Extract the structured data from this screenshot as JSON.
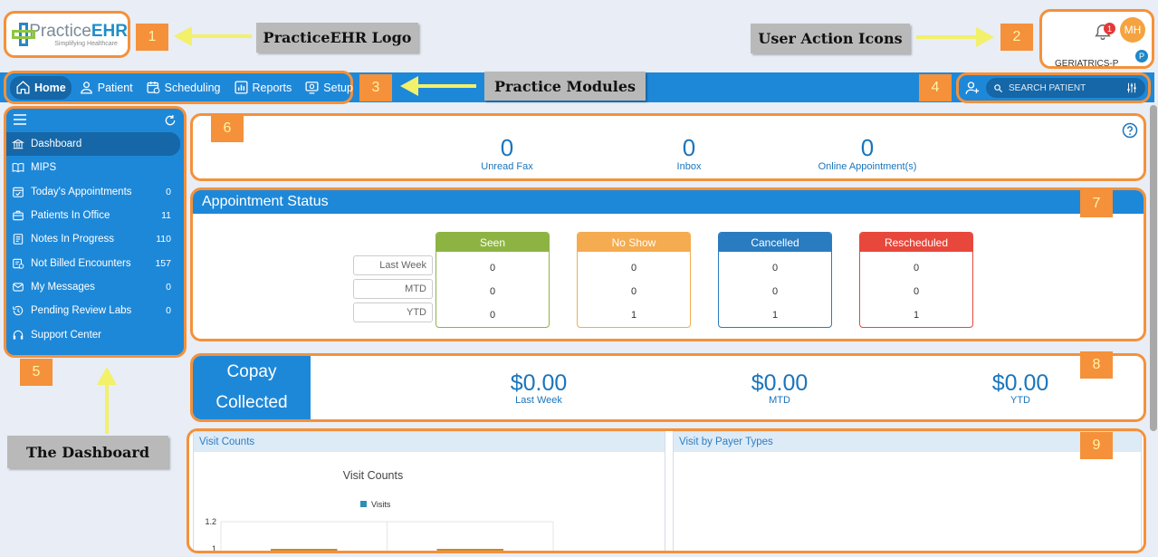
{
  "logo": {
    "brand_light": "Practice",
    "brand_bold": "EHR",
    "tagline": "Simplifying Healthcare"
  },
  "callouts": {
    "logo": "PracticeEHR Logo",
    "user_actions": "User Action Icons",
    "modules": "Practice Modules",
    "dashboard": "The Dashboard"
  },
  "markers": [
    "1",
    "2",
    "3",
    "4",
    "5",
    "6",
    "7",
    "8",
    "9"
  ],
  "user": {
    "initials": "MH",
    "notification_count": "1",
    "practice": "GERIATRICS-P",
    "badge": "P"
  },
  "nav": [
    {
      "label": "Home",
      "icon": "home-icon"
    },
    {
      "label": "Patient",
      "icon": "user-icon"
    },
    {
      "label": "Scheduling",
      "icon": "calendar-icon"
    },
    {
      "label": "Reports",
      "icon": "bar-chart-icon"
    },
    {
      "label": "Setup",
      "icon": "settings-screen-icon"
    }
  ],
  "search": {
    "placeholder": "SEARCH PATIENT"
  },
  "sidebar": [
    {
      "label": "Dashboard",
      "count": "",
      "icon": "bank-icon"
    },
    {
      "label": "MIPS",
      "count": "",
      "icon": "book-icon"
    },
    {
      "label": "Today's Appointments",
      "count": "0",
      "icon": "calendar-check-icon"
    },
    {
      "label": "Patients In Office",
      "count": "11",
      "icon": "briefcase-icon"
    },
    {
      "label": "Notes In Progress",
      "count": "110",
      "icon": "notes-icon"
    },
    {
      "label": "Not Billed Encounters",
      "count": "157",
      "icon": "bill-icon"
    },
    {
      "label": "My Messages",
      "count": "0",
      "icon": "mail-icon"
    },
    {
      "label": "Pending Review Labs",
      "count": "0",
      "icon": "history-icon"
    },
    {
      "label": "Support Center",
      "count": "",
      "icon": "headset-icon"
    }
  ],
  "counts": [
    {
      "value": "0",
      "label": "Unread Fax"
    },
    {
      "value": "0",
      "label": "Inbox"
    },
    {
      "value": "0",
      "label": "Online Appointment(s)"
    }
  ],
  "appointment_status": {
    "title": "Appointment Status",
    "rows": [
      "Last Week",
      "MTD",
      "YTD"
    ],
    "columns": [
      {
        "label": "Seen",
        "color": "#8db443",
        "values": [
          "0",
          "0",
          "0"
        ]
      },
      {
        "label": "No Show",
        "color": "#f5ab4f",
        "values": [
          "0",
          "0",
          "1"
        ]
      },
      {
        "label": "Cancelled",
        "color": "#2a7cc0",
        "values": [
          "0",
          "0",
          "1"
        ]
      },
      {
        "label": "Rescheduled",
        "color": "#e8473b",
        "values": [
          "0",
          "0",
          "1"
        ]
      }
    ]
  },
  "copay": {
    "title_line1": "Copay",
    "title_line2": "Collected",
    "items": [
      {
        "value": "$0.00",
        "label": "Last Week"
      },
      {
        "value": "$0.00",
        "label": "MTD"
      },
      {
        "value": "$0.00",
        "label": "YTD"
      }
    ]
  },
  "charts": {
    "visit_counts": {
      "tab": "Visit Counts",
      "title": "Visit Counts",
      "legend": "Visits",
      "y_ticks": [
        "1.2",
        "1"
      ]
    },
    "payer_types": {
      "tab": "Visit by Payer Types"
    }
  },
  "chart_data": {
    "type": "bar",
    "title": "Visit Counts",
    "series": [
      {
        "name": "Visits",
        "values": [
          1,
          1
        ]
      }
    ],
    "categories": [
      "",
      ""
    ],
    "ylim": [
      1,
      1.2
    ],
    "y_ticks": [
      1,
      1.2
    ],
    "legend": "top-center",
    "grid": true,
    "colors": [
      "#2e8fb5"
    ]
  },
  "colors": {
    "accent": "#1e88d8",
    "accent_dark": "#1567a8",
    "highlight": "#f4913a",
    "callout_bg": "#b9b9b9",
    "arrow": "#f3f06a"
  }
}
